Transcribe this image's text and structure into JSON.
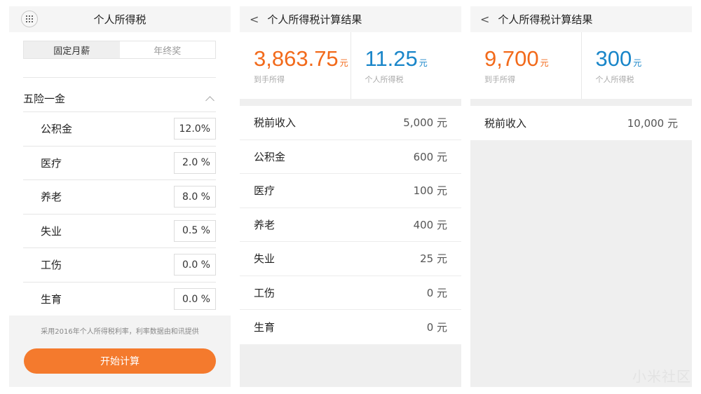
{
  "form": {
    "title": "个人所得税",
    "tabs": [
      {
        "label": "固定月薪",
        "active": true
      },
      {
        "label": "年终奖",
        "active": false
      }
    ],
    "section_title": "五险一金",
    "rates": [
      {
        "label": "公积金",
        "value": "12.0%"
      },
      {
        "label": "医疗",
        "value": "2.0 %"
      },
      {
        "label": "养老",
        "value": "8.0 %"
      },
      {
        "label": "失业",
        "value": "0.5 %"
      },
      {
        "label": "工伤",
        "value": "0.0 %"
      },
      {
        "label": "生育",
        "value": "0.0 %"
      }
    ],
    "footnote": "采用2016年个人所得税利率，利率数据由和讯提供",
    "calc_button": "开始计算"
  },
  "result_monthly": {
    "title": "个人所得税计算结果",
    "net": {
      "value": "3,863.75",
      "unit": "元",
      "label": "到手所得"
    },
    "tax": {
      "value": "11.25",
      "unit": "元",
      "label": "个人所得税"
    },
    "rows": [
      {
        "label": "税前收入",
        "value": "5,000 元"
      },
      {
        "label": "公积金",
        "value": "600 元"
      },
      {
        "label": "医疗",
        "value": "100 元"
      },
      {
        "label": "养老",
        "value": "400 元"
      },
      {
        "label": "失业",
        "value": "25 元"
      },
      {
        "label": "工伤",
        "value": "0 元"
      },
      {
        "label": "生育",
        "value": "0 元"
      }
    ]
  },
  "result_bonus": {
    "title": "个人所得税计算结果",
    "net": {
      "value": "9,700",
      "unit": "元",
      "label": "到手所得"
    },
    "tax": {
      "value": "300",
      "unit": "元",
      "label": "个人所得税"
    },
    "rows": [
      {
        "label": "税前收入",
        "value": "10,000 元"
      }
    ]
  },
  "watermark": "小米社区",
  "colors": {
    "accent": "#f47a2d",
    "net_amount": "#f26a1b",
    "tax_amount": "#1a86c9"
  },
  "icons": {
    "menu": "grid-menu-icon",
    "back": "chevron-left-icon",
    "collapse": "chevron-up-icon"
  }
}
